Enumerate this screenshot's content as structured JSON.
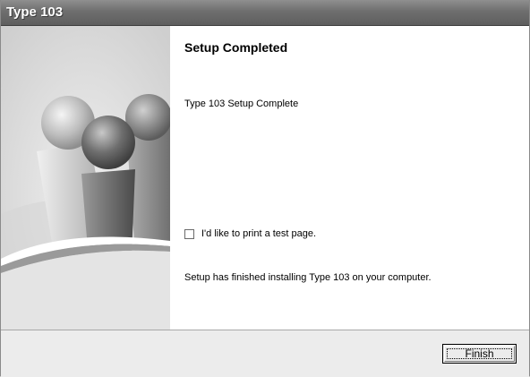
{
  "window": {
    "title": "Type 103"
  },
  "content": {
    "heading": "Setup Completed",
    "subtitle": "Type 103 Setup Complete",
    "checkbox": {
      "label": "I'd like to print a test page.",
      "checked": false
    },
    "finish_message": "Setup has finished installing Type 103 on your computer."
  },
  "footer": {
    "finish_label": "Finish"
  },
  "illustration": {
    "name": "people-figures-illustration"
  }
}
